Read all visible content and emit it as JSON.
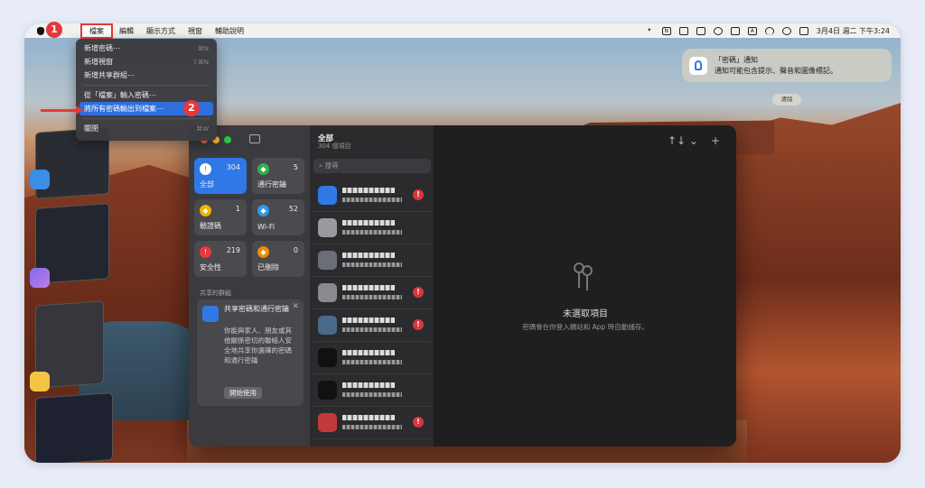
{
  "menubar": {
    "items": [
      "檔案",
      "編輯",
      "顯示方式",
      "視窗",
      "輔助說明"
    ],
    "status_icons": [
      "dropbox-icon",
      "n-icon",
      "link-icon",
      "mirror-icon",
      "user-icon",
      "display-icon",
      "input-a-icon",
      "wifi-icon",
      "search-icon",
      "control-center-icon"
    ],
    "input_label": "A",
    "n_label": "N",
    "clock": "3月4日 週二 下午3:24"
  },
  "file_menu": {
    "items": [
      {
        "label": "新增密碼⋯",
        "shortcut": "⌘N"
      },
      {
        "label": "新增視窗",
        "shortcut": "⇧⌘N"
      },
      {
        "label": "新增共享群組⋯",
        "shortcut": ""
      },
      {
        "label": "從「檔案」輸入密碼⋯",
        "shortcut": ""
      },
      {
        "label": "將所有密碼輸出到檔案⋯",
        "shortcut": ""
      },
      {
        "label": "關閉",
        "shortcut": "⌘W"
      }
    ]
  },
  "callouts": {
    "step1": "1",
    "step2": "2"
  },
  "notification": {
    "title": "「密碼」通知",
    "body": "通知可能包含提示、聲音和圖像標記。",
    "clear": "清除"
  },
  "sidebar": {
    "tiles": [
      {
        "label": "全部",
        "count": "304",
        "icon": "!",
        "color": "#ffffff"
      },
      {
        "label": "通行密鑰",
        "count": "5",
        "icon": "◆",
        "color": "#30b04a"
      },
      {
        "label": "驗證碼",
        "count": "1",
        "icon": "◆",
        "color": "#f0b400"
      },
      {
        "label": "Wi-Fi",
        "count": "52",
        "icon": "◆",
        "color": "#2f9be5"
      },
      {
        "label": "安全性",
        "count": "219",
        "icon": "!",
        "color": "#e5383b"
      },
      {
        "label": "已刪除",
        "count": "0",
        "icon": "◆",
        "color": "#f08a00"
      }
    ],
    "section_label": "共享的群組",
    "promo": {
      "title": "共享密碼和通行密鑰",
      "body": "你能與家人、朋友或其他關係密切的聯絡人安全地共享你選擇的密碼和通行密鑰",
      "button": "開始使用",
      "close": "✕"
    }
  },
  "list": {
    "title": "全部",
    "subtitle": "304 個項目",
    "search_placeholder": "搜尋",
    "rows": [
      {
        "icon_color": "#2f78e5",
        "warn": true
      },
      {
        "icon_color": "#9a9a9e",
        "warn": false
      },
      {
        "icon_color": "#6a6e78",
        "warn": false
      },
      {
        "icon_color": "#8a8a8e",
        "warn": true
      },
      {
        "icon_color": "#4a6a8a",
        "warn": true
      },
      {
        "icon_color": "#111111",
        "warn": false
      },
      {
        "icon_color": "#111111",
        "warn": false
      },
      {
        "icon_color": "#c23a3a",
        "warn": true
      }
    ]
  },
  "toolbar": {
    "sort": "↑↓ ⌄",
    "add": "+"
  },
  "detail": {
    "empty_title": "未選取項目",
    "empty_sub": "密碼會在你登入網站和 App 時自動儲存。"
  }
}
